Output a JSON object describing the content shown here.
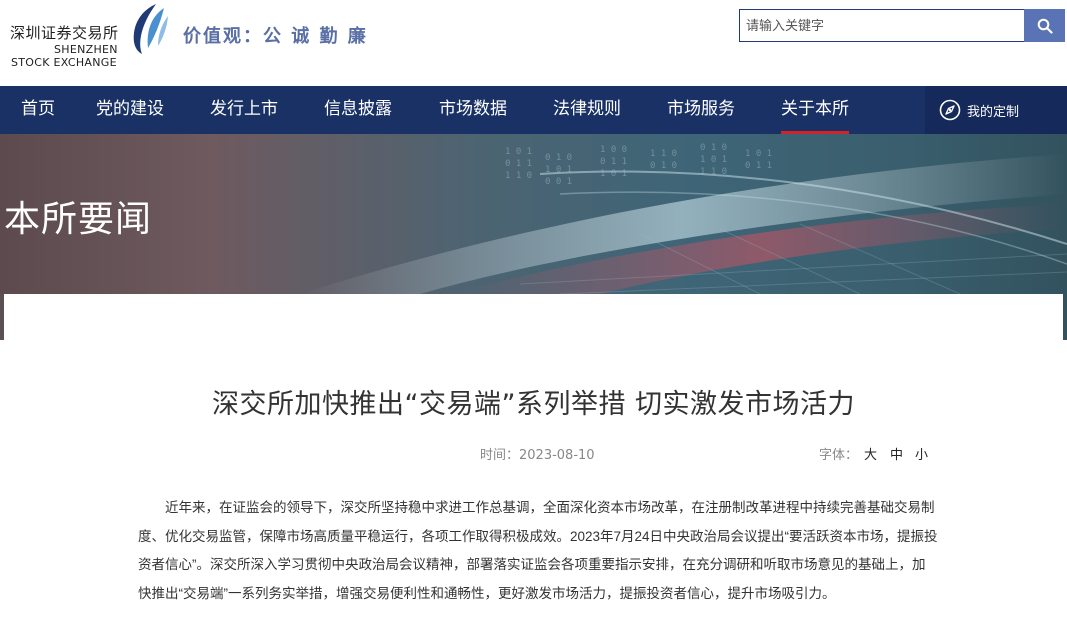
{
  "header": {
    "logo_cn": "深圳证券交易所",
    "logo_en_line1": "SHENZHEN",
    "logo_en_line2": "STOCK EXCHANGE",
    "slogan": "价值观：公 诚 勤 廉",
    "search_placeholder": "请输入关键字",
    "search_icon": "search-icon"
  },
  "nav": {
    "items": [
      {
        "label": "首页",
        "active": false
      },
      {
        "label": "党的建设",
        "active": false
      },
      {
        "label": "发行上市",
        "active": false
      },
      {
        "label": "信息披露",
        "active": false
      },
      {
        "label": "市场数据",
        "active": false
      },
      {
        "label": "法律规则",
        "active": false
      },
      {
        "label": "市场服务",
        "active": false
      },
      {
        "label": "关于本所",
        "active": true
      }
    ],
    "custom_label": "我的定制",
    "custom_icon": "compass-icon",
    "active_color": "#d0242b"
  },
  "banner": {
    "title": "本所要闻"
  },
  "article": {
    "title": "深交所加快推出“交易端”系列举措 切实激发市场活力",
    "time": "时间：2023-08-10",
    "font_label": "字体：",
    "font_options": [
      "大",
      "中",
      "小"
    ],
    "body": "近年来，在证监会的领导下，深交所坚持稳中求进工作总基调，全面深化资本市场改革，在注册制改革进程中持续完善基础交易制度、优化交易监管，保障市场高质量平稳运行，各项工作取得积极成效。2023年7月24日中央政治局会议提出“要活跃资本市场，提振投资者信心”。深交所深入学习贯彻中央政治局会议精神，部署落实证监会各项重要指示安排，在充分调研和听取市场意见的基础上，加快推出“交易端”一系列务实举措，增强交易便利性和通畅性，更好激发市场活力，提振投资者信心，提升市场吸引力。"
  },
  "colors": {
    "nav_bg": "#1a3165",
    "search_btn": "#5a73b5",
    "slogan": "#5a6fa6"
  }
}
